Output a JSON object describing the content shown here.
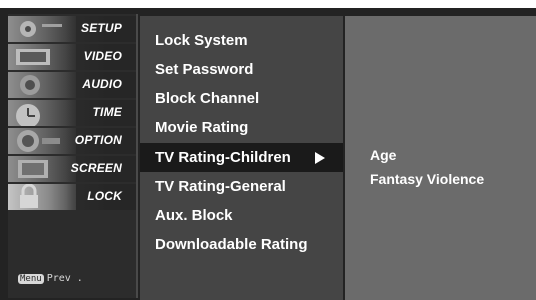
{
  "left_menu": {
    "items": [
      {
        "label": "SETUP",
        "icon": "setup-icon"
      },
      {
        "label": "VIDEO",
        "icon": "video-icon"
      },
      {
        "label": "AUDIO",
        "icon": "audio-icon"
      },
      {
        "label": "TIME",
        "icon": "time-icon"
      },
      {
        "label": "OPTION",
        "icon": "option-icon"
      },
      {
        "label": "SCREEN",
        "icon": "screen-icon"
      },
      {
        "label": "LOCK",
        "icon": "lock-icon"
      }
    ],
    "active": "LOCK",
    "footer_key": "Menu",
    "footer_text": "Prev ."
  },
  "lock_menu": {
    "items": [
      "Lock System",
      "Set Password",
      "Block Channel",
      "Movie Rating",
      "TV Rating-Children",
      "TV Rating-General",
      "Aux. Block",
      "Downloadable Rating"
    ],
    "selected": "TV Rating-Children"
  },
  "submenu": {
    "items": [
      "Age",
      "Fantasy Violence"
    ]
  },
  "colors": {
    "frame": "#232323",
    "list_bg": "#454545",
    "selected_bg": "#1a1a1a",
    "submenu_bg": "#6b6b6b",
    "text": "#ffffff"
  }
}
